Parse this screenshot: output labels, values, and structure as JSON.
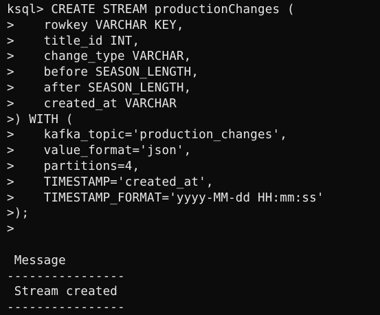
{
  "terminal": {
    "lines": [
      "ksql> CREATE STREAM productionChanges (",
      ">    rowkey VARCHAR KEY,",
      ">    title_id INT,",
      ">    change_type VARCHAR,",
      ">    before SEASON_LENGTH,",
      ">    after SEASON_LENGTH,",
      ">    created_at VARCHAR",
      ">) WITH (",
      ">    kafka_topic='production_changes',",
      ">    value_format='json',",
      ">    partitions=4,",
      ">    TIMESTAMP='created_at',",
      ">    TIMESTAMP_FORMAT='yyyy-MM-dd HH:mm:ss'",
      ">);",
      ">",
      "",
      " Message",
      "----------------",
      " Stream created",
      "----------------"
    ]
  },
  "colors": {
    "background": "#0c0c0c",
    "foreground": "#e6e6e6"
  }
}
